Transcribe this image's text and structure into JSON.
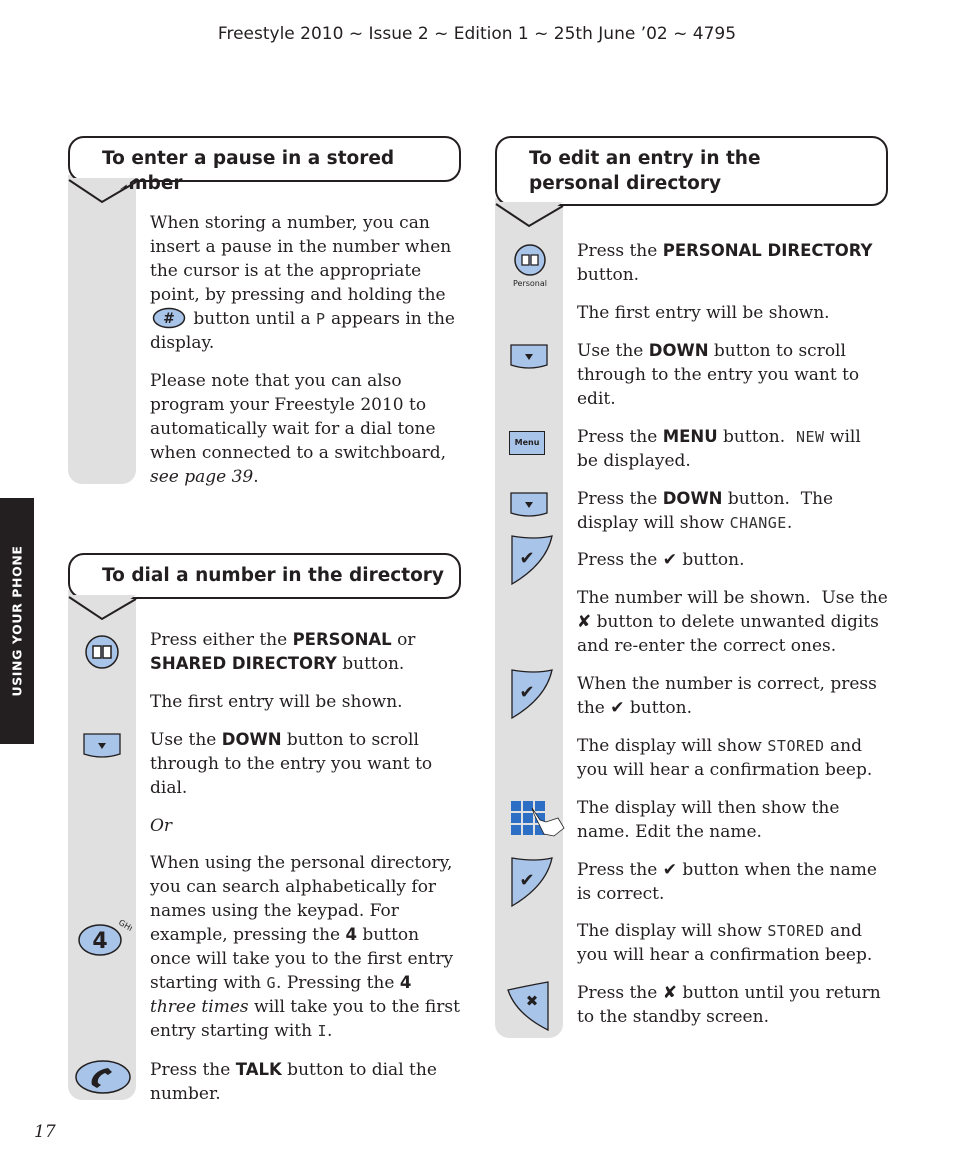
{
  "header": {
    "running_title": "Freestyle 2010 ~ Issue 2 ~ Edition 1 ~ 25th June ’02 ~ 4795"
  },
  "side_tab": {
    "label": "USING YOUR PHONE"
  },
  "page_number": "17",
  "colors": {
    "button_fill": "#a8c4e8",
    "gutter": "#e0e0e1",
    "ink": "#231f20",
    "keypad_blue": "#2d6fc4"
  },
  "glyphs": {
    "check": "✔",
    "cross": "✘"
  },
  "sections": {
    "pause": {
      "title": "To enter a pause in a stored number",
      "p1_a": "When storing a number, you can insert a pause in the number when the cursor is at the appropriate point, by pressing and holding the",
      "p1_icon": "hash-button-icon",
      "p1_b": " button until a ",
      "p1_lcd": "P",
      "p1_c": " appears in the display.",
      "p2_a": "Please note that you can also program your Freestyle 2010 to automatically wait for a dial tone when connected to a switchboard, ",
      "p2_link": "see page 39",
      "p2_b": "."
    },
    "dial": {
      "title": "To dial a number in the directory",
      "s1_a": "Press either the ",
      "s1_b1": "PERSONAL",
      "s1_c": " or ",
      "s1_b2": "SHARED DIRECTORY",
      "s1_d": " button.",
      "s2": "The first entry will be shown.",
      "s3_a": "Use the ",
      "s3_b": "DOWN",
      "s3_c": " button to scroll through to the entry you want to dial.",
      "s4": "Or",
      "s5_a": "When using the personal directory, you can search alphabetically for names using the keypad. For example, pressing the ",
      "s5_b1": "4",
      "s5_c": " button once will take you to the first entry starting with ",
      "s5_lcd1": "G",
      "s5_d": ". Pressing the ",
      "s5_b2": "4",
      "s5_e": " ",
      "s5_i": "three times",
      "s5_f": " will take you to the first entry starting with ",
      "s5_lcd2": "I",
      "s5_g": ".",
      "s6_a": "Press the ",
      "s6_b": "TALK",
      "s6_c": " button to dial the number.",
      "icon_key4_digit": "4",
      "icon_key4_letters": "GHI"
    },
    "edit": {
      "title": "To edit an entry in the personal directory",
      "s1_a": "Press the ",
      "s1_b": "PERSONAL DIRECTORY",
      "s1_c": " button.",
      "icon_personal_label": "Personal",
      "s2": "The first entry will be shown.",
      "s3_a": "Use the ",
      "s3_b": "DOWN",
      "s3_c": " button to scroll through to the entry you want to edit.",
      "s4_a": "Press the ",
      "s4_b": "MENU",
      "s4_c": " button.  ",
      "s4_lcd": "NEW",
      "s4_d": " will be displayed.",
      "menu_label": "Menu",
      "s5_a": "Press the ",
      "s5_b": "DOWN",
      "s5_c": " button.  The display will show ",
      "s5_lcd": "CHANGE",
      "s5_d": ".",
      "s6_a": "Press the ",
      "s6_c": " button.",
      "s7_a": "The number will be shown.  Use the ",
      "s7_c": " button to delete unwanted digits and re-enter the correct ones.",
      "s8_a": "When the number is correct, press the ",
      "s8_c": " button.",
      "s9_a": "The display will show ",
      "s9_lcd": "STORED",
      "s9_b": " and you will hear a confirmation beep.",
      "s10": "The display will then show the name. Edit the name.",
      "s11_a": "Press the ",
      "s11_c": " button when the name is correct.",
      "s12_a": "The display will show ",
      "s12_lcd": "STORED",
      "s12_b": " and you will hear a confirmation beep.",
      "s13_a": "Press the ",
      "s13_c": " button until you return to the standby screen."
    }
  }
}
